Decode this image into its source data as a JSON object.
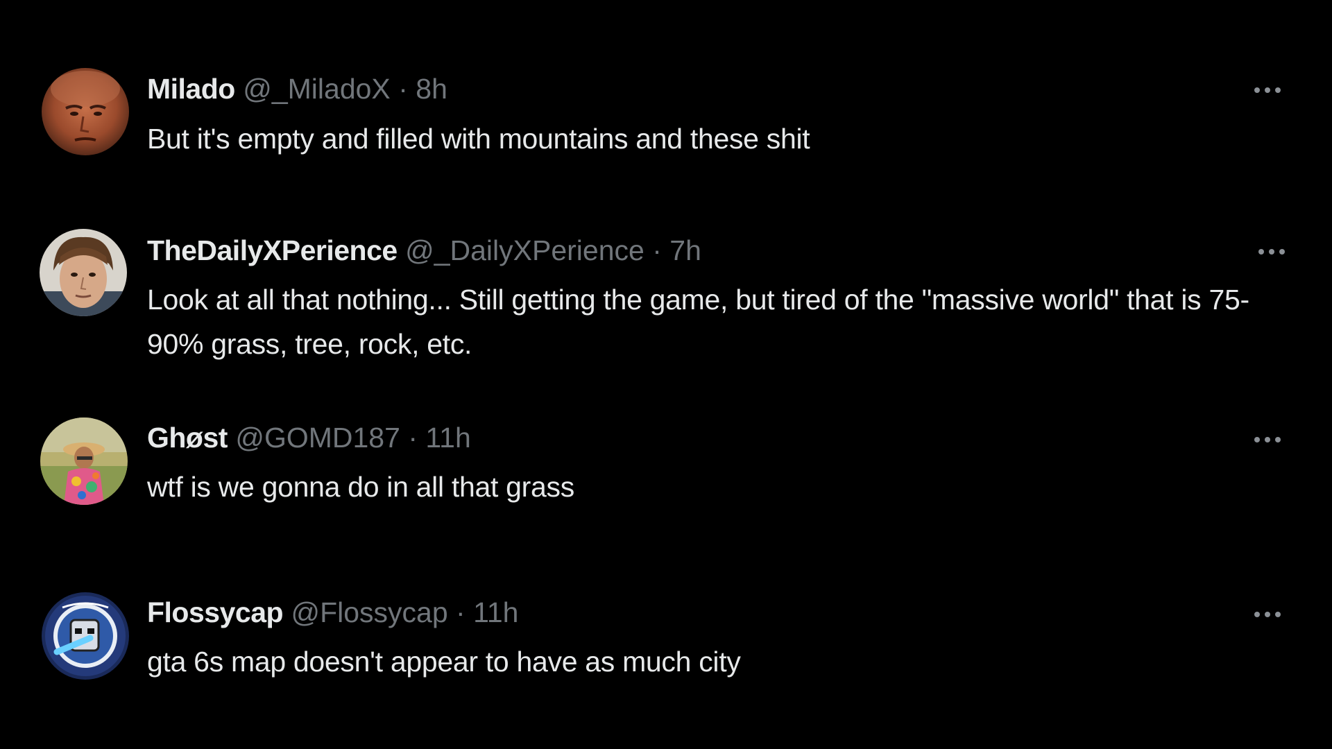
{
  "replies": [
    {
      "name": "Milado",
      "handle": "@_MiladoX",
      "separator": "·",
      "time": "8h",
      "text": "But it's empty and filled with mountains and these shit",
      "avatar_icon": "avatar-photo-face"
    },
    {
      "name": "TheDailyXPerience",
      "handle": "@_DailyXPerience",
      "separator": "·",
      "time": "7h",
      "text": "Look at all that nothing... Still getting the game, but tired of the \"massive world\" that is 75-90% grass, tree, rock, etc.",
      "avatar_icon": "avatar-photo-face"
    },
    {
      "name": "Ghøst",
      "handle": "@GOMD187",
      "separator": "·",
      "time": "11h",
      "text": "wtf is we gonna do in all that grass",
      "avatar_icon": "avatar-photo-figure"
    },
    {
      "name": "Flossycap",
      "handle": "@Flossycap",
      "separator": "·",
      "time": "11h",
      "text": "gta 6s map doesn't appear to have as much city",
      "avatar_icon": "avatar-logo-badge"
    }
  ],
  "more_icon": "more-horizontal-icon",
  "colors": {
    "background": "#000000",
    "primary_text": "#e7e9ea",
    "secondary_text": "#71767b"
  }
}
